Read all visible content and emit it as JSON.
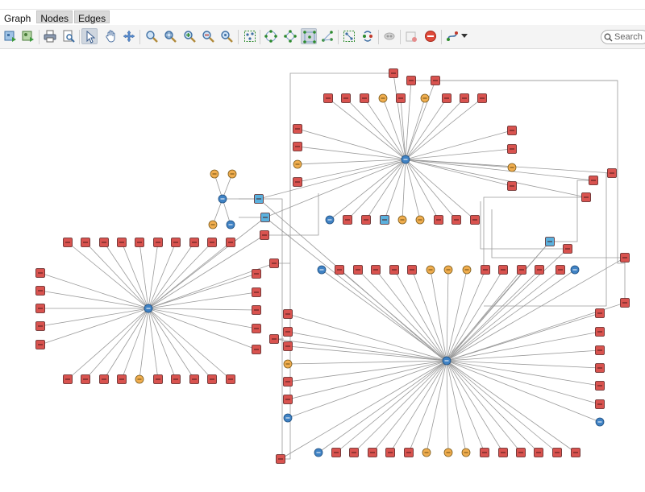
{
  "tabs": [
    {
      "label": "Graph",
      "active": true
    },
    {
      "label": "Nodes",
      "active": false
    },
    {
      "label": "Edges",
      "active": false
    }
  ],
  "toolbar": {
    "buttons": [
      {
        "name": "export-network-icon"
      },
      {
        "name": "export-image-icon"
      },
      {
        "name": "print-icon"
      },
      {
        "name": "print-preview-icon"
      },
      {
        "name": "select-cursor-icon",
        "selected": true
      },
      {
        "name": "pan-hand-icon"
      },
      {
        "name": "move-arrows-icon"
      },
      {
        "name": "zoom-icon"
      },
      {
        "name": "zoom-in-icon"
      },
      {
        "name": "zoom-in-plus-icon"
      },
      {
        "name": "zoom-out-minus-icon"
      },
      {
        "name": "zoom-fit-icon"
      },
      {
        "name": "fit-selection-icon"
      },
      {
        "name": "layout-circle-icon"
      },
      {
        "name": "layout-diamond-icon"
      },
      {
        "name": "layout-grid-icon",
        "selected": true
      },
      {
        "name": "layout-tree-icon"
      },
      {
        "name": "bundle-edges-icon"
      },
      {
        "name": "refresh-layout-icon"
      },
      {
        "name": "hide-edges-icon"
      },
      {
        "name": "add-node-icon"
      },
      {
        "name": "delete-icon"
      },
      {
        "name": "style-menu-icon"
      }
    ]
  },
  "search": {
    "placeholder": "Search"
  },
  "colors": {
    "square_node": "#d9534f",
    "circle_node": "#f0ad4e",
    "blue_circle": "#3f82c4",
    "blue_square": "#5bb1de",
    "edge": "#9a9a9a"
  },
  "graph": {
    "clusters": [
      {
        "name": "top-hub",
        "hub": "blue",
        "periphery": [
          "sq",
          "sq",
          "sq",
          "sq",
          "sq",
          "sq",
          "sq",
          "sq",
          "sq",
          "ci",
          "sq",
          "sq",
          "sq",
          "ci",
          "sq",
          "sq",
          "sq",
          "sq",
          "sq",
          "sq",
          "sq",
          "sq",
          "sq",
          "sq",
          "ci",
          "sq",
          "sq",
          "sq",
          "sq",
          "ci",
          "sq",
          "sq",
          "sq",
          "bs",
          "ci",
          "sq",
          "ci",
          "sq",
          "bc",
          "sq",
          "sq",
          "sq",
          "sq"
        ]
      },
      {
        "name": "left-hub",
        "hub": "blue",
        "periphery": [
          "sq",
          "sq",
          "sq",
          "sq",
          "sq",
          "sq",
          "sq",
          "sq",
          "sq",
          "sq",
          "sq",
          "sq",
          "sq",
          "sq",
          "sq",
          "sq",
          "sq",
          "sq",
          "sq",
          "sq",
          "ci",
          "sq",
          "sq",
          "sq",
          "sq",
          "sq",
          "sq",
          "sq",
          "sq",
          "sq"
        ]
      },
      {
        "name": "bottom-hub",
        "hub": "blue",
        "periphery": [
          "sq",
          "sq",
          "sq",
          "sq",
          "ci",
          "ci",
          "ci",
          "sq",
          "sq",
          "sq",
          "sq",
          "sq",
          "sq",
          "bc",
          "sq",
          "sq",
          "sq",
          "sq",
          "sq",
          "sq",
          "bc",
          "sq",
          "sq",
          "sq",
          "sq",
          "ci",
          "ci",
          "ci",
          "sq",
          "sq",
          "sq",
          "sq",
          "sq",
          "sq",
          "sq",
          "bc",
          "sq",
          "sq",
          "sq",
          "sq",
          "ci",
          "sq",
          "sq",
          "bc"
        ]
      },
      {
        "name": "small-hub",
        "hub": "blue",
        "periphery": [
          "ci",
          "ci",
          "ci",
          "bc"
        ]
      }
    ]
  }
}
